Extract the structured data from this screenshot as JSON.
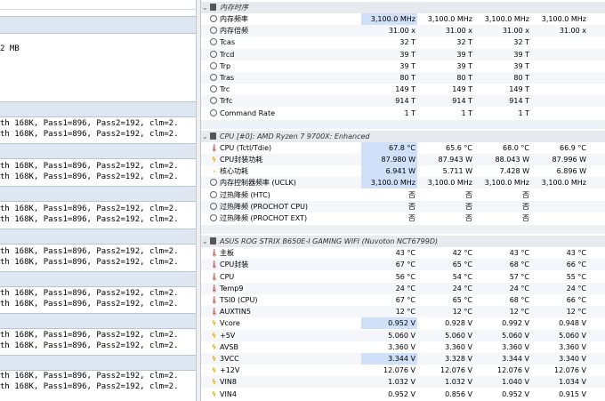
{
  "left": {
    "top_text": "2 MB",
    "log_line_a": "th 168K, Pass1=896, Pass2=192, clm=2.",
    "log_line_b": "th 168K, Pass1=896, Pass2=192, clm=2."
  },
  "sections": [
    {
      "title": "内存时序",
      "rows": [
        {
          "icon": "clock",
          "name": "内存频率",
          "v": [
            "3,100.0 MHz",
            "3,100.0 MHz",
            "3,100.0 MHz",
            "3,100.0 MHz"
          ],
          "hl": true
        },
        {
          "icon": "clock",
          "name": "内存倍频",
          "v": [
            "31.00 x",
            "31.00 x",
            "31.00 x",
            "31.00 x"
          ]
        },
        {
          "icon": "clock",
          "name": "Tcas",
          "v": [
            "32 T",
            "32 T",
            "32 T",
            ""
          ]
        },
        {
          "icon": "clock",
          "name": "Trcd",
          "v": [
            "39 T",
            "39 T",
            "39 T",
            ""
          ]
        },
        {
          "icon": "clock",
          "name": "Trp",
          "v": [
            "39 T",
            "39 T",
            "39 T",
            ""
          ]
        },
        {
          "icon": "clock",
          "name": "Tras",
          "v": [
            "80 T",
            "80 T",
            "80 T",
            ""
          ]
        },
        {
          "icon": "clock",
          "name": "Trc",
          "v": [
            "149 T",
            "149 T",
            "149 T",
            ""
          ]
        },
        {
          "icon": "clock",
          "name": "Trfc",
          "v": [
            "914 T",
            "914 T",
            "914 T",
            ""
          ]
        },
        {
          "icon": "clock",
          "name": "Command Rate",
          "v": [
            "1 T",
            "1 T",
            "1 T",
            ""
          ]
        }
      ]
    },
    {
      "title": "CPU [#0]: AMD Ryzen 7 9700X: Enhanced",
      "rows": [
        {
          "icon": "therm",
          "name": "CPU (Tctl/Tdie)",
          "v": [
            "67.8 °C",
            "65.6 °C",
            "68.0 °C",
            "66.9 °C"
          ],
          "hl": true
        },
        {
          "icon": "bolt",
          "name": "CPU封装功耗",
          "v": [
            "87.980 W",
            "87.943 W",
            "88.043 W",
            "87.996 W"
          ],
          "hl": true
        },
        {
          "icon": "arrow",
          "name": "核心功耗",
          "v": [
            "6.941 W",
            "5.711 W",
            "7.428 W",
            "6.896 W"
          ],
          "hl": true
        },
        {
          "icon": "clock",
          "name": "内存控制器频率 (UCLK)",
          "v": [
            "3,100.0 MHz",
            "3,100.0 MHz",
            "3,100.0 MHz",
            "3,100.0 MHz"
          ],
          "hl": true
        },
        {
          "icon": "clock",
          "name": "过热降频 (HTC)",
          "v": [
            "否",
            "否",
            "否",
            ""
          ]
        },
        {
          "icon": "clock",
          "name": "过热降频 (PROCHOT CPU)",
          "v": [
            "否",
            "否",
            "否",
            ""
          ]
        },
        {
          "icon": "clock",
          "name": "过热降频 (PROCHOT EXT)",
          "v": [
            "否",
            "否",
            "否",
            ""
          ]
        }
      ]
    },
    {
      "title": "ASUS ROG STRIX B650E-I GAMING WIFI (Nuvoton NCT6799D)",
      "rows": [
        {
          "icon": "therm",
          "name": "主板",
          "v": [
            "43 °C",
            "42 °C",
            "43 °C",
            "43 °C"
          ]
        },
        {
          "icon": "therm",
          "name": "CPU封装",
          "v": [
            "67 °C",
            "65 °C",
            "68 °C",
            "66 °C"
          ]
        },
        {
          "icon": "therm",
          "name": "CPU",
          "v": [
            "56 °C",
            "54 °C",
            "57 °C",
            "55 °C"
          ]
        },
        {
          "icon": "therm",
          "name": "Temp9",
          "v": [
            "24 °C",
            "24 °C",
            "24 °C",
            "24 °C"
          ]
        },
        {
          "icon": "therm",
          "name": "TSI0 (CPU)",
          "v": [
            "67 °C",
            "65 °C",
            "68 °C",
            "66 °C"
          ]
        },
        {
          "icon": "therm",
          "name": "AUXTIN5",
          "v": [
            "12 °C",
            "12 °C",
            "12 °C",
            "12 °C"
          ]
        },
        {
          "icon": "bolt",
          "name": "Vcore",
          "v": [
            "0.952 V",
            "0.928 V",
            "0.992 V",
            "0.948 V"
          ],
          "hl": true
        },
        {
          "icon": "bolt",
          "name": "+5V",
          "v": [
            "5.060 V",
            "5.060 V",
            "5.060 V",
            "5.060 V"
          ]
        },
        {
          "icon": "bolt",
          "name": "AVSB",
          "v": [
            "3.360 V",
            "3.360 V",
            "3.360 V",
            "3.360 V"
          ]
        },
        {
          "icon": "bolt",
          "name": "3VCC",
          "v": [
            "3.344 V",
            "3.328 V",
            "3.344 V",
            "3.340 V"
          ],
          "hl": true
        },
        {
          "icon": "bolt",
          "name": "+12V",
          "v": [
            "12.076 V",
            "12.076 V",
            "12.076 V",
            "12.076 V"
          ]
        },
        {
          "icon": "bolt",
          "name": "VIN8",
          "v": [
            "1.032 V",
            "1.032 V",
            "1.040 V",
            "1.034 V"
          ]
        },
        {
          "icon": "bolt",
          "name": "VIN4",
          "v": [
            "0.952 V",
            "0.856 V",
            "0.952 V",
            "0.915 V"
          ]
        }
      ]
    }
  ]
}
